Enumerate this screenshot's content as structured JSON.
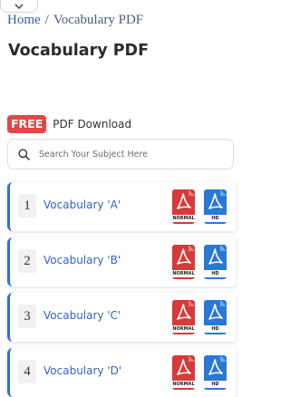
{
  "breadcrumb": {
    "home": "Home",
    "separator": "/",
    "current": "Vocabulary PDF"
  },
  "page": {
    "title": "Vocabulary PDF"
  },
  "promo": {
    "badge": "FREE",
    "text": "PDF Download"
  },
  "search": {
    "placeholder": "Search Your Subject Here",
    "value": ""
  },
  "items": [
    {
      "number": "1",
      "title": "Vocabulary 'A'",
      "normal_label": "NORMAL",
      "hd_label": "HD"
    },
    {
      "number": "2",
      "title": "Vocabulary 'B'",
      "normal_label": "NORMAL",
      "hd_label": "HD"
    },
    {
      "number": "3",
      "title": "Vocabulary 'C'",
      "normal_label": "NORMAL",
      "hd_label": "HD"
    },
    {
      "number": "4",
      "title": "Vocabulary 'D'",
      "normal_label": "NORMAL",
      "hd_label": "HD"
    }
  ],
  "colors": {
    "accent": "#2f6fd6",
    "badge": "#e24747",
    "pdf_normal": "#d83a3a",
    "pdf_hd": "#2a78d6",
    "link": "#2f66c9"
  },
  "icons": {
    "collapse": "chevron-down-icon",
    "search": "search-icon",
    "pdf": "pdf-file-icon"
  }
}
